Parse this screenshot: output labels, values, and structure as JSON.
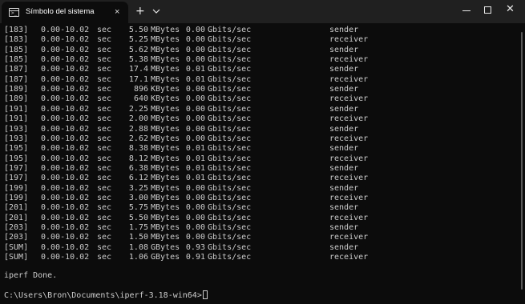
{
  "titlebar": {
    "tab_title": "Símbolo del sistema",
    "tab_icon": "terminal-icon",
    "close_tab_glyph": "×",
    "new_tab_glyph": "+",
    "dropdown_icon": "chevron-down-icon",
    "minimize_icon": "minimize-icon",
    "maximize_icon": "maximize-icon",
    "close_window_glyph": "✕"
  },
  "terminal": {
    "background": "#0c0c0c",
    "foreground": "#cccccc",
    "rows": [
      {
        "id": "[183]",
        "interval": "0.00-10.02",
        "unit": "sec",
        "transfer": "5.50",
        "transfer_unit": "MBytes",
        "bitrate": "0.00",
        "bitrate_unit": "Gbits/sec",
        "role": "sender"
      },
      {
        "id": "[183]",
        "interval": "0.00-10.02",
        "unit": "sec",
        "transfer": "5.25",
        "transfer_unit": "MBytes",
        "bitrate": "0.00",
        "bitrate_unit": "Gbits/sec",
        "role": "receiver"
      },
      {
        "id": "[185]",
        "interval": "0.00-10.02",
        "unit": "sec",
        "transfer": "5.62",
        "transfer_unit": "MBytes",
        "bitrate": "0.00",
        "bitrate_unit": "Gbits/sec",
        "role": "sender"
      },
      {
        "id": "[185]",
        "interval": "0.00-10.02",
        "unit": "sec",
        "transfer": "5.38",
        "transfer_unit": "MBytes",
        "bitrate": "0.00",
        "bitrate_unit": "Gbits/sec",
        "role": "receiver"
      },
      {
        "id": "[187]",
        "interval": "0.00-10.02",
        "unit": "sec",
        "transfer": "17.4",
        "transfer_unit": "MBytes",
        "bitrate": "0.01",
        "bitrate_unit": "Gbits/sec",
        "role": "sender"
      },
      {
        "id": "[187]",
        "interval": "0.00-10.02",
        "unit": "sec",
        "transfer": "17.1",
        "transfer_unit": "MBytes",
        "bitrate": "0.01",
        "bitrate_unit": "Gbits/sec",
        "role": "receiver"
      },
      {
        "id": "[189]",
        "interval": "0.00-10.02",
        "unit": "sec",
        "transfer": "896",
        "transfer_unit": "KBytes",
        "bitrate": "0.00",
        "bitrate_unit": "Gbits/sec",
        "role": "sender"
      },
      {
        "id": "[189]",
        "interval": "0.00-10.02",
        "unit": "sec",
        "transfer": "640",
        "transfer_unit": "KBytes",
        "bitrate": "0.00",
        "bitrate_unit": "Gbits/sec",
        "role": "receiver"
      },
      {
        "id": "[191]",
        "interval": "0.00-10.02",
        "unit": "sec",
        "transfer": "2.25",
        "transfer_unit": "MBytes",
        "bitrate": "0.00",
        "bitrate_unit": "Gbits/sec",
        "role": "sender"
      },
      {
        "id": "[191]",
        "interval": "0.00-10.02",
        "unit": "sec",
        "transfer": "2.00",
        "transfer_unit": "MBytes",
        "bitrate": "0.00",
        "bitrate_unit": "Gbits/sec",
        "role": "receiver"
      },
      {
        "id": "[193]",
        "interval": "0.00-10.02",
        "unit": "sec",
        "transfer": "2.88",
        "transfer_unit": "MBytes",
        "bitrate": "0.00",
        "bitrate_unit": "Gbits/sec",
        "role": "sender"
      },
      {
        "id": "[193]",
        "interval": "0.00-10.02",
        "unit": "sec",
        "transfer": "2.62",
        "transfer_unit": "MBytes",
        "bitrate": "0.00",
        "bitrate_unit": "Gbits/sec",
        "role": "receiver"
      },
      {
        "id": "[195]",
        "interval": "0.00-10.02",
        "unit": "sec",
        "transfer": "8.38",
        "transfer_unit": "MBytes",
        "bitrate": "0.01",
        "bitrate_unit": "Gbits/sec",
        "role": "sender"
      },
      {
        "id": "[195]",
        "interval": "0.00-10.02",
        "unit": "sec",
        "transfer": "8.12",
        "transfer_unit": "MBytes",
        "bitrate": "0.01",
        "bitrate_unit": "Gbits/sec",
        "role": "receiver"
      },
      {
        "id": "[197]",
        "interval": "0.00-10.02",
        "unit": "sec",
        "transfer": "6.38",
        "transfer_unit": "MBytes",
        "bitrate": "0.01",
        "bitrate_unit": "Gbits/sec",
        "role": "sender"
      },
      {
        "id": "[197]",
        "interval": "0.00-10.02",
        "unit": "sec",
        "transfer": "6.12",
        "transfer_unit": "MBytes",
        "bitrate": "0.01",
        "bitrate_unit": "Gbits/sec",
        "role": "receiver"
      },
      {
        "id": "[199]",
        "interval": "0.00-10.02",
        "unit": "sec",
        "transfer": "3.25",
        "transfer_unit": "MBytes",
        "bitrate": "0.00",
        "bitrate_unit": "Gbits/sec",
        "role": "sender"
      },
      {
        "id": "[199]",
        "interval": "0.00-10.02",
        "unit": "sec",
        "transfer": "3.00",
        "transfer_unit": "MBytes",
        "bitrate": "0.00",
        "bitrate_unit": "Gbits/sec",
        "role": "receiver"
      },
      {
        "id": "[201]",
        "interval": "0.00-10.02",
        "unit": "sec",
        "transfer": "5.75",
        "transfer_unit": "MBytes",
        "bitrate": "0.00",
        "bitrate_unit": "Gbits/sec",
        "role": "sender"
      },
      {
        "id": "[201]",
        "interval": "0.00-10.02",
        "unit": "sec",
        "transfer": "5.50",
        "transfer_unit": "MBytes",
        "bitrate": "0.00",
        "bitrate_unit": "Gbits/sec",
        "role": "receiver"
      },
      {
        "id": "[203]",
        "interval": "0.00-10.02",
        "unit": "sec",
        "transfer": "1.75",
        "transfer_unit": "MBytes",
        "bitrate": "0.00",
        "bitrate_unit": "Gbits/sec",
        "role": "sender"
      },
      {
        "id": "[203]",
        "interval": "0.00-10.02",
        "unit": "sec",
        "transfer": "1.50",
        "transfer_unit": "MBytes",
        "bitrate": "0.00",
        "bitrate_unit": "Gbits/sec",
        "role": "receiver"
      },
      {
        "id": "[SUM]",
        "interval": "0.00-10.02",
        "unit": "sec",
        "transfer": "1.08",
        "transfer_unit": "GBytes",
        "bitrate": "0.93",
        "bitrate_unit": "Gbits/sec",
        "role": "sender"
      },
      {
        "id": "[SUM]",
        "interval": "0.00-10.02",
        "unit": "sec",
        "transfer": "1.06",
        "transfer_unit": "GBytes",
        "bitrate": "0.91",
        "bitrate_unit": "Gbits/sec",
        "role": "receiver"
      }
    ],
    "done_message": "iperf Done.",
    "prompt": "C:\\Users\\Bron\\Documents\\iperf-3.18-win64>"
  }
}
